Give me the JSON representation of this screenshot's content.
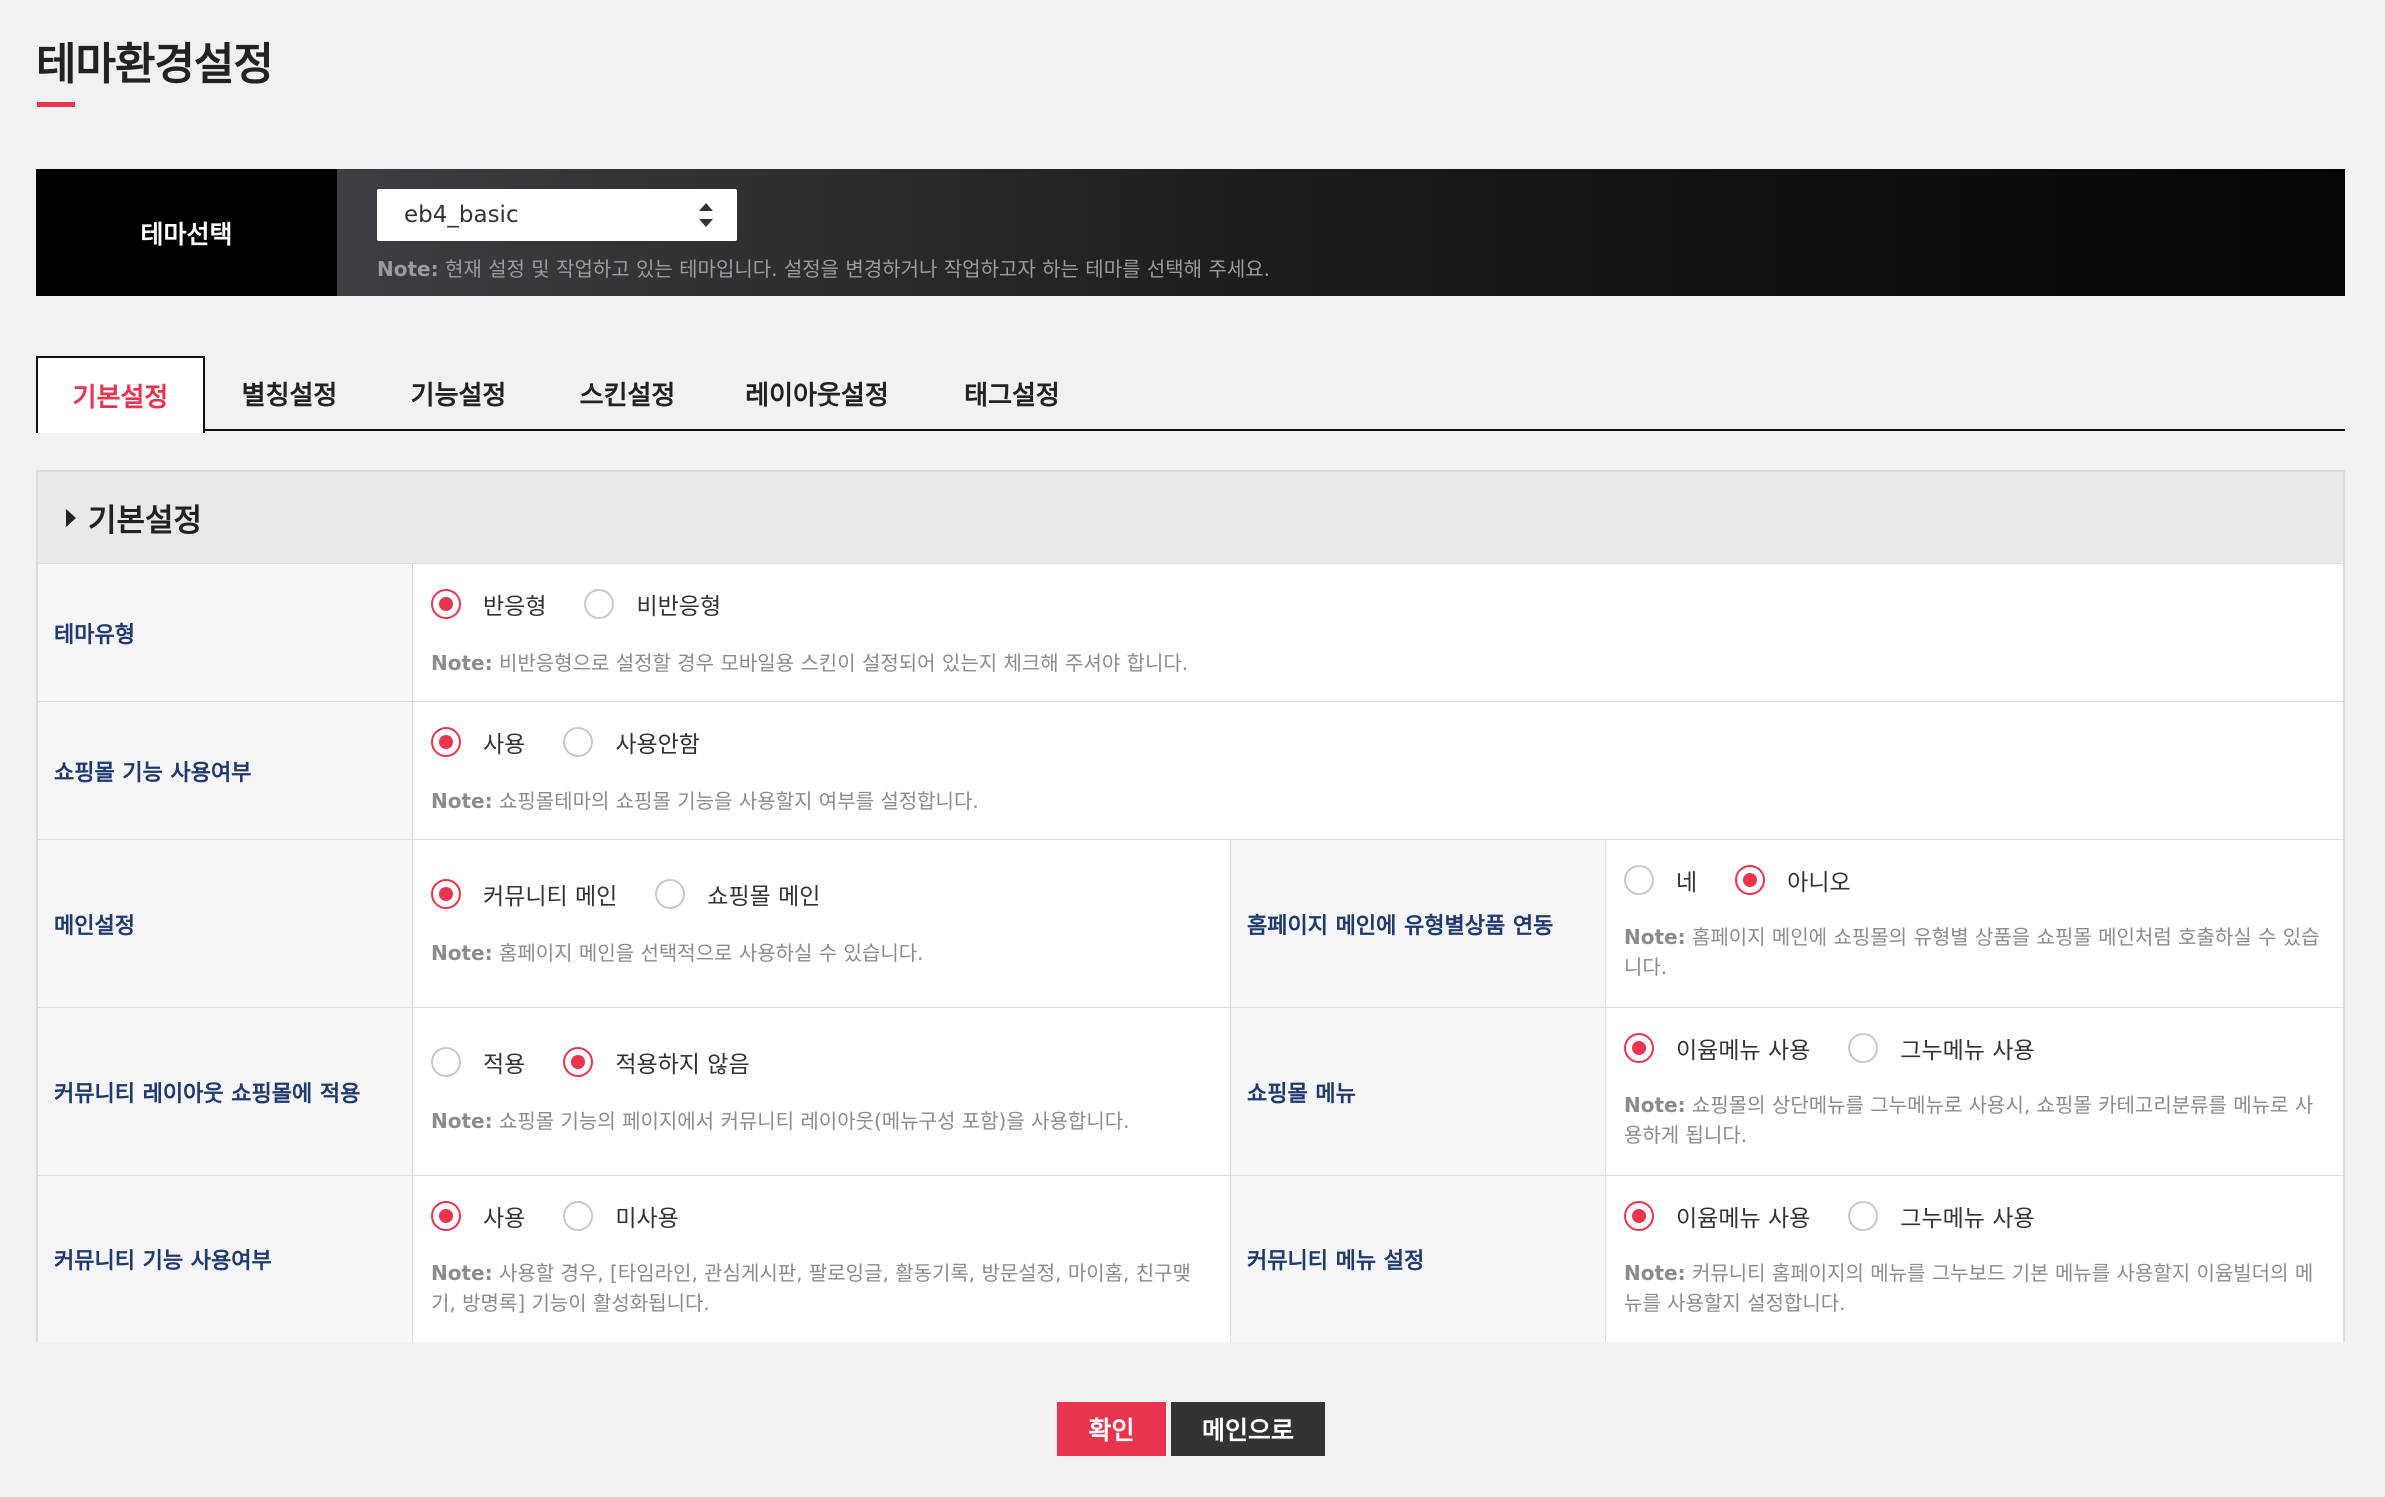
{
  "page": {
    "title": "테마환경설정"
  },
  "theme": {
    "label": "테마선택",
    "selected": "eb4_basic",
    "note_prefix": "Note:",
    "note": "현재 설정 및 작업하고 있는 테마입니다. 설정을 변경하거나 작업하고자 하는 테마를 선택해 주세요."
  },
  "tabs": [
    "기본설정",
    "별칭설정",
    "기능설정",
    "스킨설정",
    "레이아웃설정",
    "태그설정"
  ],
  "active_tab": "기본설정",
  "section": {
    "title": "기본설정"
  },
  "settings": {
    "theme_type": {
      "label": "테마유형",
      "options": [
        "반응형",
        "비반응형"
      ],
      "selected": "반응형",
      "note_prefix": "Note:",
      "note": "비반응형으로 설정할 경우 모바일용 스킨이 설정되어 있는지 체크해 주셔야 합니다."
    },
    "shop_usage": {
      "label": "쇼핑몰 기능 사용여부",
      "options": [
        "사용",
        "사용안함"
      ],
      "selected": "사용",
      "note_prefix": "Note:",
      "note": "쇼핑몰테마의 쇼핑몰 기능을 사용할지 여부를 설정합니다."
    },
    "main_setting": {
      "label": "메인설정",
      "options": [
        "커뮤니티 메인",
        "쇼핑몰 메인"
      ],
      "selected": "커뮤니티 메인",
      "note_prefix": "Note:",
      "note": "홈페이지 메인을 선택적으로 사용하실 수 있습니다."
    },
    "main_product_link": {
      "label": "홈페이지 메인에 유형별상품 연동",
      "options": [
        "네",
        "아니오"
      ],
      "selected": "아니오",
      "note_prefix": "Note:",
      "note": "홈페이지 메인에 쇼핑몰의 유형별 상품을 쇼핑몰 메인처럼 호출하실 수 있습니다."
    },
    "community_layout": {
      "label": "커뮤니티 레이아웃 쇼핑몰에 적용",
      "options": [
        "적용",
        "적용하지 않음"
      ],
      "selected": "적용하지 않음",
      "note_prefix": "Note:",
      "note": "쇼핑몰 기능의 페이지에서 커뮤니티 레이아웃(메뉴구성 포함)을 사용합니다."
    },
    "shop_menu": {
      "label": "쇼핑몰 메뉴",
      "options": [
        "이윰메뉴 사용",
        "그누메뉴 사용"
      ],
      "selected": "이윰메뉴 사용",
      "note_prefix": "Note:",
      "note": "쇼핑몰의 상단메뉴를 그누메뉴로 사용시, 쇼핑몰 카테고리분류를 메뉴로 사용하게 됩니다."
    },
    "community_usage": {
      "label": "커뮤니티 기능 사용여부",
      "options": [
        "사용",
        "미사용"
      ],
      "selected": "사용",
      "note_prefix": "Note:",
      "note": "사용할 경우, [타임라인, 관심게시판, 팔로잉글, 활동기록, 방문설정, 마이홈, 친구맺기, 방명록] 기능이 활성화됩니다."
    },
    "community_menu": {
      "label": "커뮤니티 메뉴 설정",
      "options": [
        "이윰메뉴 사용",
        "그누메뉴 사용"
      ],
      "selected": "이윰메뉴 사용",
      "note_prefix": "Note:",
      "note": "커뮤니티 홈페이지의 메뉴를 그누보드 기본 메뉴를 사용할지 이윰빌더의 메뉴를 사용할지 설정합니다."
    }
  },
  "buttons": {
    "confirm": "확인",
    "main": "메인으로"
  },
  "colors": {
    "accent": "#e8344e",
    "label_text": "#1f3a6e",
    "dark_button": "#333336"
  }
}
